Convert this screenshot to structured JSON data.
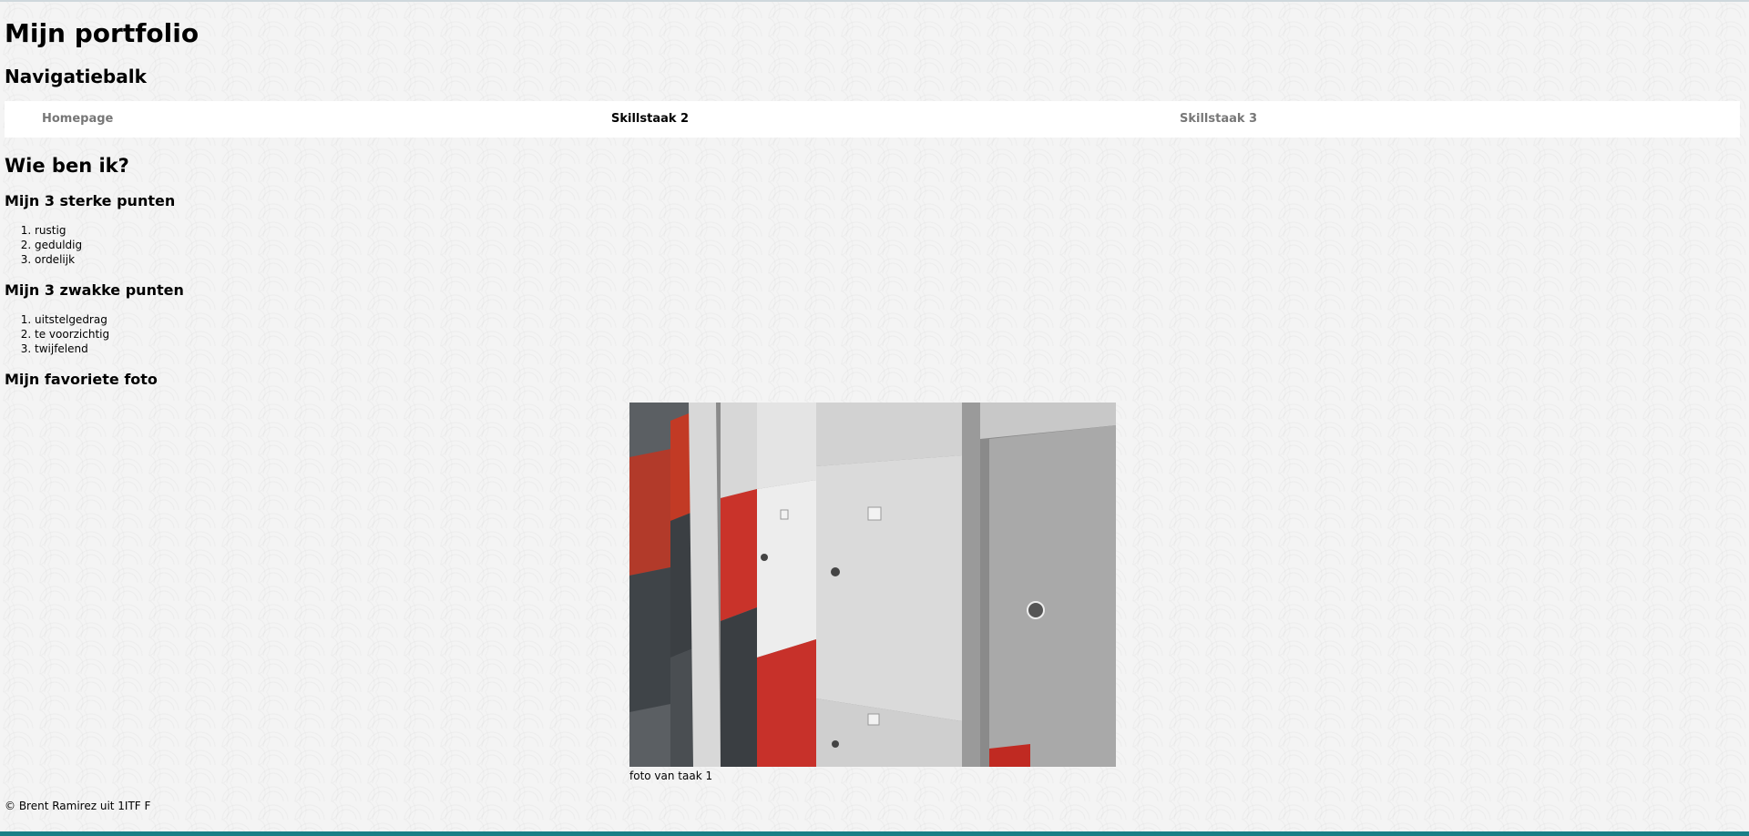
{
  "page": {
    "title": "Mijn portfolio",
    "nav_heading": "Navigatiebalk",
    "nav": [
      {
        "label": "Homepage",
        "active": false
      },
      {
        "label": "Skillstaak 2",
        "active": true
      },
      {
        "label": "Skillstaak 3",
        "active": false
      }
    ],
    "about_heading": "Wie ben ik?",
    "strong_heading": "Mijn 3 sterke punten",
    "strong_points": [
      "rustig",
      "geduldig",
      "ordelijk"
    ],
    "weak_heading": "Mijn 3 zwakke punten",
    "weak_points": [
      "uitstelgedrag",
      "te voorzichtig",
      "twijfelend"
    ],
    "photo_heading": "Mijn favoriete foto",
    "photo_caption": "foto van taak 1",
    "footer": "© Brent Ramirez uit 1ITF F"
  },
  "colors": {
    "nav_bg": "#ffffff",
    "nav_link": "#777777",
    "nav_active": "#000000",
    "taskbar": "#1a7f86"
  }
}
